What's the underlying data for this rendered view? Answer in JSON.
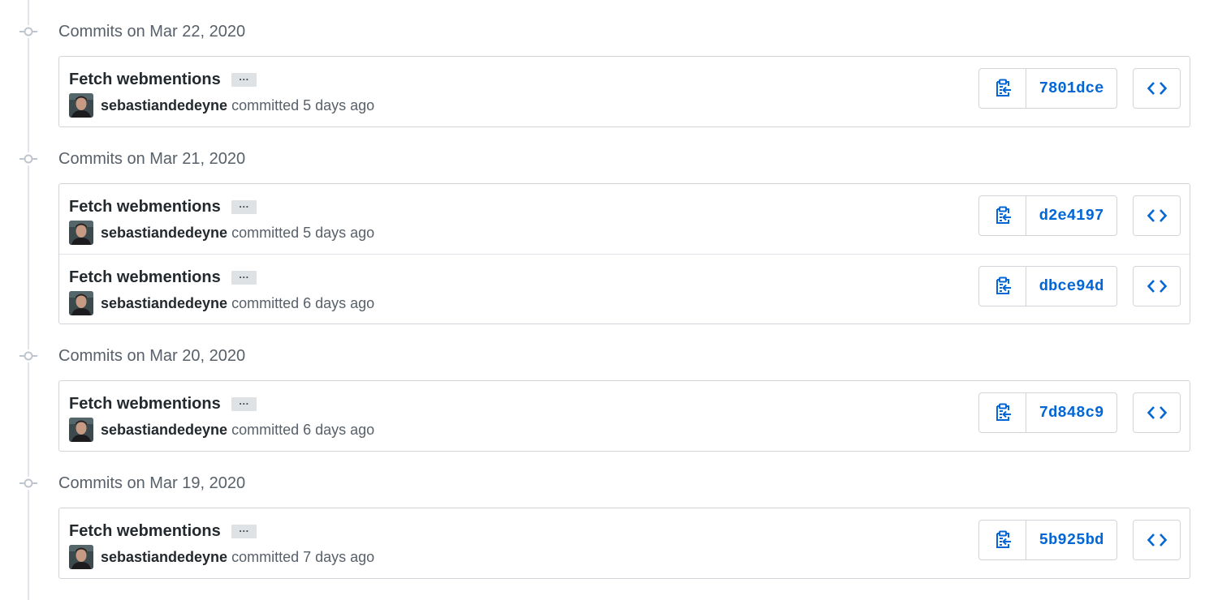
{
  "accent_color": "#0366d6",
  "icons": {
    "commit_node": "git-commit-icon",
    "copy": "clippy-icon",
    "browse": "code-icon"
  },
  "groups": [
    {
      "title": "Commits on Mar 22, 2020",
      "commits": [
        {
          "message": "Fetch webmentions",
          "ellipsis": "…",
          "author": "sebastiandedeyne",
          "committed": "committed",
          "time": "5 days ago",
          "sha": "7801dce"
        }
      ]
    },
    {
      "title": "Commits on Mar 21, 2020",
      "commits": [
        {
          "message": "Fetch webmentions",
          "ellipsis": "…",
          "author": "sebastiandedeyne",
          "committed": "committed",
          "time": "5 days ago",
          "sha": "d2e4197"
        },
        {
          "message": "Fetch webmentions",
          "ellipsis": "…",
          "author": "sebastiandedeyne",
          "committed": "committed",
          "time": "6 days ago",
          "sha": "dbce94d"
        }
      ]
    },
    {
      "title": "Commits on Mar 20, 2020",
      "commits": [
        {
          "message": "Fetch webmentions",
          "ellipsis": "…",
          "author": "sebastiandedeyne",
          "committed": "committed",
          "time": "6 days ago",
          "sha": "7d848c9"
        }
      ]
    },
    {
      "title": "Commits on Mar 19, 2020",
      "commits": [
        {
          "message": "Fetch webmentions",
          "ellipsis": "…",
          "author": "sebastiandedeyne",
          "committed": "committed",
          "time": "7 days ago",
          "sha": "5b925bd"
        }
      ]
    }
  ]
}
